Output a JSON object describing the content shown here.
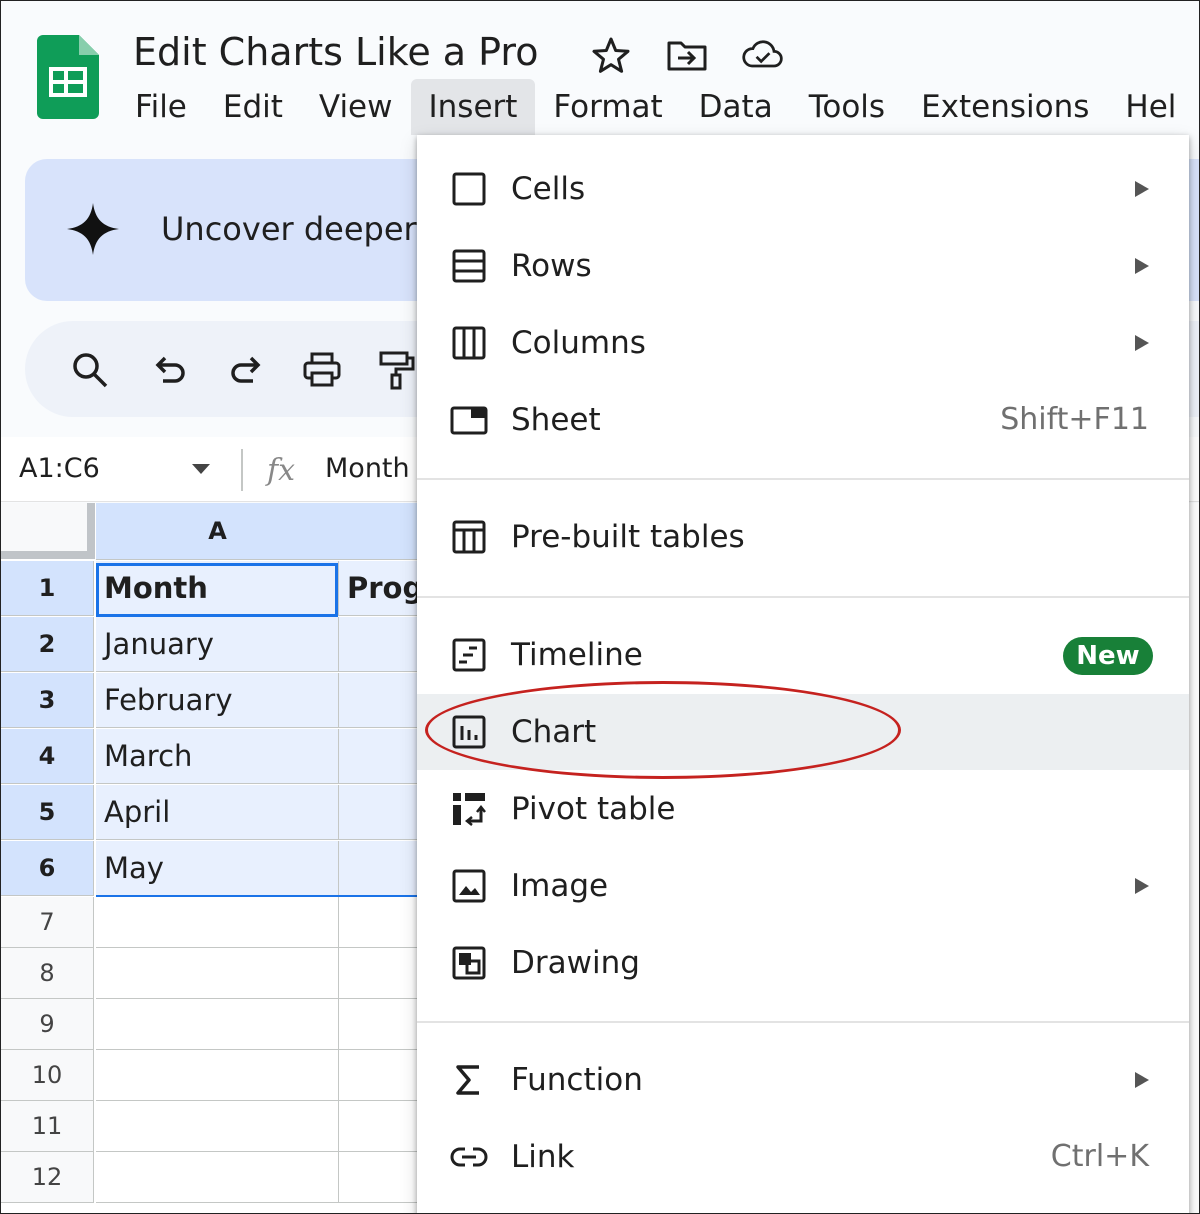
{
  "app": {
    "doc_title": "Edit Charts Like a Pro",
    "icons": [
      "sheets-logo",
      "star-icon",
      "move-to-folder-icon",
      "cloud-saved-icon"
    ],
    "brand_color": "#0f9d58"
  },
  "menubar": {
    "items": [
      "File",
      "Edit",
      "View",
      "Insert",
      "Format",
      "Data",
      "Tools",
      "Extensions",
      "Hel"
    ],
    "active": "Insert"
  },
  "banner": {
    "text": "Uncover deeper"
  },
  "toolbar": {
    "icons": [
      "search-icon",
      "undo-icon",
      "redo-icon",
      "print-icon",
      "paint-format-icon"
    ]
  },
  "formula_bar": {
    "name_box": "A1:C6",
    "formula_value": "Month"
  },
  "grid": {
    "column_headers": [
      "A"
    ],
    "rows": [
      {
        "num": "1",
        "a": "Month",
        "b": "Progr"
      },
      {
        "num": "2",
        "a": "January",
        "b": ""
      },
      {
        "num": "3",
        "a": "February",
        "b": ""
      },
      {
        "num": "4",
        "a": "March",
        "b": ""
      },
      {
        "num": "5",
        "a": "April",
        "b": ""
      },
      {
        "num": "6",
        "a": "May",
        "b": ""
      },
      {
        "num": "7",
        "a": "",
        "b": ""
      },
      {
        "num": "8",
        "a": "",
        "b": ""
      },
      {
        "num": "9",
        "a": "",
        "b": ""
      },
      {
        "num": "10",
        "a": "",
        "b": ""
      },
      {
        "num": "11",
        "a": "",
        "b": ""
      },
      {
        "num": "12",
        "a": "",
        "b": ""
      }
    ],
    "selection_color": "#d3e3fd",
    "active_cell_border": "#1a73e8"
  },
  "insert_menu": {
    "items": [
      {
        "label": "Cells",
        "icon": "cells-icon",
        "submenu": true
      },
      {
        "label": "Rows",
        "icon": "rows-icon",
        "submenu": true
      },
      {
        "label": "Columns",
        "icon": "columns-icon",
        "submenu": true
      },
      {
        "label": "Sheet",
        "icon": "sheet-icon",
        "shortcut": "Shift+F11"
      },
      {
        "label": "Pre-built tables",
        "icon": "table-icon"
      },
      {
        "label": "Timeline",
        "icon": "timeline-icon",
        "badge": "New"
      },
      {
        "label": "Chart",
        "icon": "chart-icon",
        "highlighted": true
      },
      {
        "label": "Pivot table",
        "icon": "pivot-table-icon"
      },
      {
        "label": "Image",
        "icon": "image-icon",
        "submenu": true
      },
      {
        "label": "Drawing",
        "icon": "drawing-icon"
      },
      {
        "label": "Function",
        "icon": "sigma-icon",
        "submenu": true
      },
      {
        "label": "Link",
        "icon": "link-icon",
        "shortcut": "Ctrl+K"
      }
    ],
    "badge_color": "#188038",
    "annotation_color": "#c5221f"
  }
}
